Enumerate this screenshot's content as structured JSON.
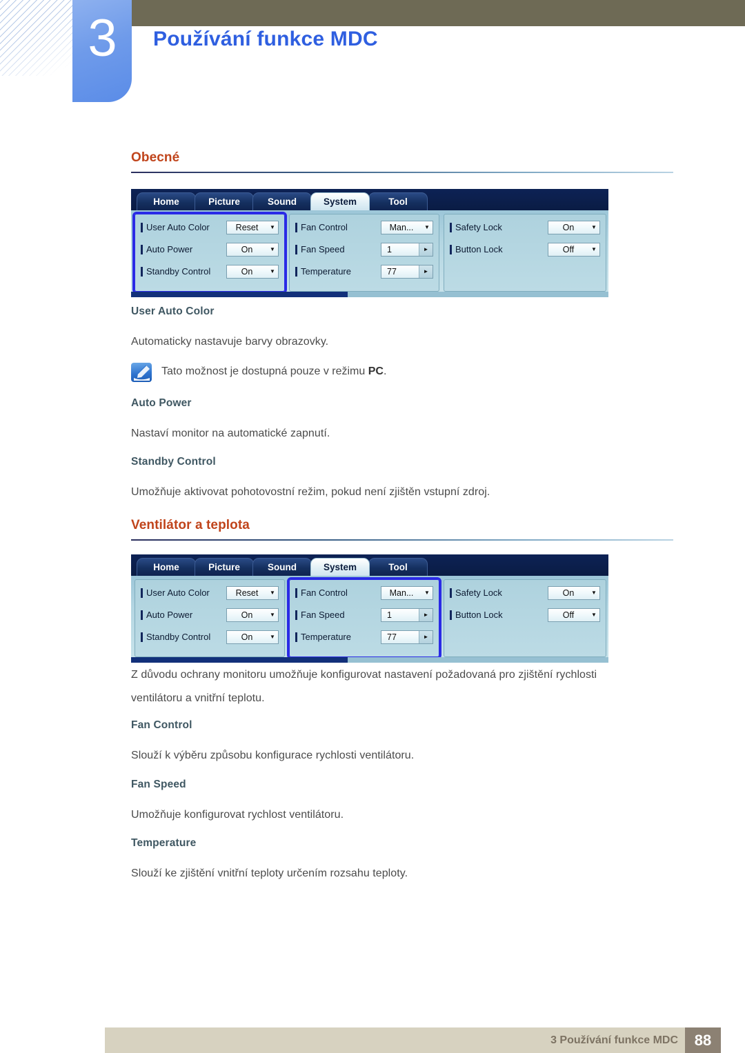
{
  "header": {
    "chapter_number": "3",
    "title": "Používání funkce MDC"
  },
  "sections": [
    {
      "id": "obecne",
      "title": "Obecné"
    },
    {
      "id": "ventilator",
      "title": "Ventilátor a teplota"
    }
  ],
  "mdc_panel": {
    "tabs": [
      {
        "label": "Home",
        "active": false
      },
      {
        "label": "Picture",
        "active": false
      },
      {
        "label": "Sound",
        "active": false
      },
      {
        "label": "System",
        "active": true
      },
      {
        "label": "Tool",
        "active": false
      }
    ],
    "group1": {
      "rows": [
        {
          "label": "User Auto Color",
          "value": "Reset",
          "control": "combo"
        },
        {
          "label": "Auto Power",
          "value": "On",
          "control": "combo"
        },
        {
          "label": "Standby Control",
          "value": "On",
          "control": "combo"
        }
      ]
    },
    "group2": {
      "rows": [
        {
          "label": "Fan Control",
          "value": "Man...",
          "control": "combo"
        },
        {
          "label": "Fan Speed",
          "value": "1",
          "control": "spin"
        },
        {
          "label": "Temperature",
          "value": "77",
          "control": "spin"
        }
      ]
    },
    "group3": {
      "rows": [
        {
          "label": "Safety Lock",
          "value": "On",
          "control": "combo"
        },
        {
          "label": "Button Lock",
          "value": "Off",
          "control": "combo"
        }
      ]
    },
    "icons": {
      "combo_arrow": "▼",
      "spin_arrow": "►"
    }
  },
  "content": {
    "user_auto_color_heading": "User Auto Color",
    "user_auto_color_body": "Automaticky nastavuje barvy obrazovky.",
    "note_text_before": "Tato možnost je dostupná pouze v režimu ",
    "note_text_bold": "PC",
    "note_text_after": ".",
    "auto_power_heading": "Auto Power",
    "auto_power_body": "Nastaví monitor na automatické zapnutí.",
    "standby_control_heading": "Standby Control",
    "standby_control_body": "Umožňuje aktivovat pohotovostní režim, pokud není zjištěn vstupní zdroj.",
    "fan_intro_line1": "Z důvodu ochrany monitoru umožňuje konfigurovat nastavení požadovaná pro zjištění rychlosti",
    "fan_intro_line2": "ventilátoru a vnitřní teplotu.",
    "fan_control_heading": "Fan Control",
    "fan_control_body": "Slouží k výběru způsobu konfigurace rychlosti ventilátoru.",
    "fan_speed_heading": "Fan Speed",
    "fan_speed_body": "Umožňuje konfigurovat rychlost ventilátoru.",
    "temperature_heading": "Temperature",
    "temperature_body": "Slouží ke zjištění vnitřní teploty určením rozsahu teploty."
  },
  "footer": {
    "text": "3 Používání funkce MDC",
    "page_number": "88"
  },
  "colors": {
    "accent_heading": "#c0441b",
    "chapter_blue": "#2f5fe0",
    "olive": "#6e6a55",
    "footer_bar": "#d7d2c0",
    "footer_page": "#8c8173",
    "selection_outline": "#2a2ae6"
  }
}
